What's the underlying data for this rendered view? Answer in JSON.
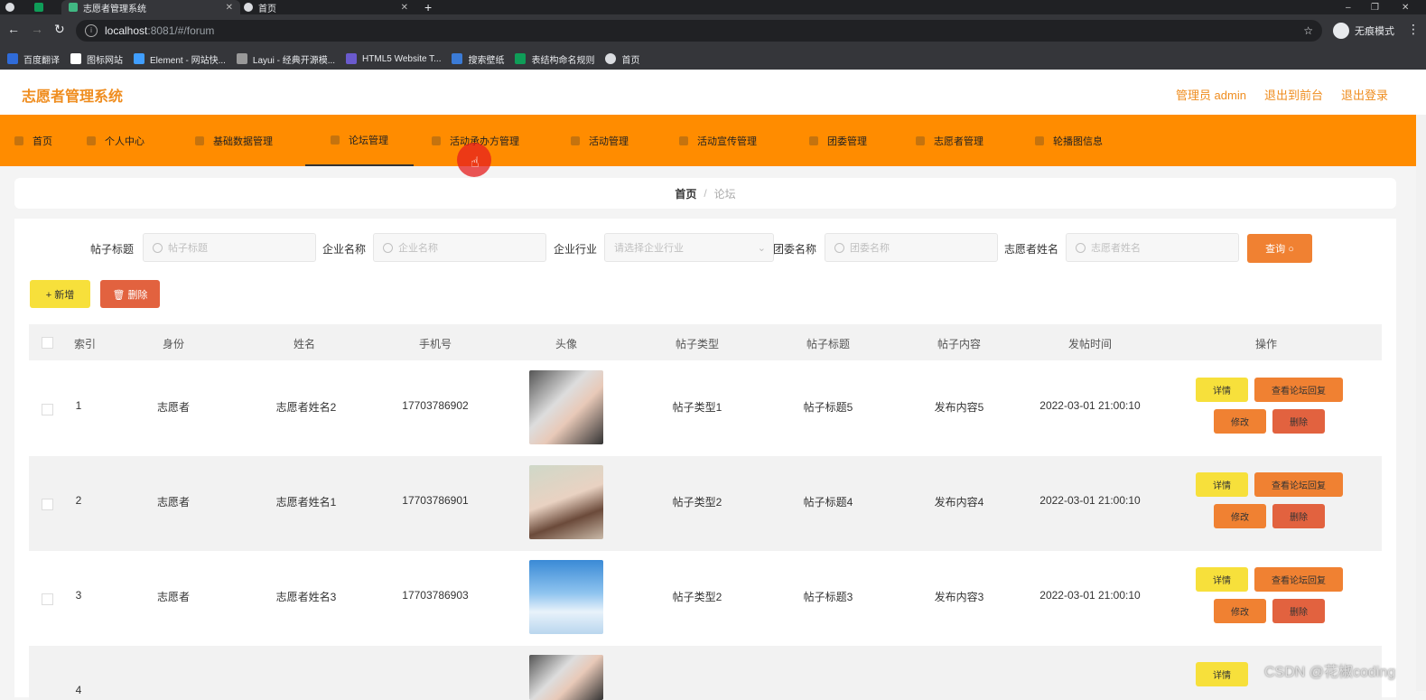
{
  "browser": {
    "tabs": [
      {
        "title": ""
      },
      {
        "title": ""
      },
      {
        "title": "志愿者管理系统"
      },
      {
        "title": "首页"
      }
    ],
    "new_tab": "+",
    "window_controls": [
      "–",
      "❐",
      "✕"
    ],
    "url_host": "localhost",
    "url_path": ":8081/#/forum",
    "incognito_label": "无痕模式",
    "bookmarks": [
      {
        "label": "百度翻译",
        "color": "#2f6bd8"
      },
      {
        "label": "图标网站",
        "color": "#ffffff"
      },
      {
        "label": "Element - 网站快...",
        "color": "#409eff"
      },
      {
        "label": "Layui - 经典开源模...",
        "color": "#999999"
      },
      {
        "label": "HTML5 Website T...",
        "color": "#6a5acd"
      },
      {
        "label": "搜索壁纸",
        "color": "#3b7bd6"
      },
      {
        "label": "表结构命名规则",
        "color": "#0f9d58"
      },
      {
        "label": "首页",
        "color": "#dadce0"
      }
    ]
  },
  "header": {
    "title": "志愿者管理系统",
    "admin": "管理员 admin",
    "to_front": "退出到前台",
    "logout": "退出登录"
  },
  "menu": [
    {
      "label": "首页"
    },
    {
      "label": "个人中心"
    },
    {
      "label": "基础数据管理"
    },
    {
      "label": "论坛管理"
    },
    {
      "label": "活动承办方管理"
    },
    {
      "label": "活动管理"
    },
    {
      "label": "活动宣传管理"
    },
    {
      "label": "团委管理"
    },
    {
      "label": "志愿者管理"
    },
    {
      "label": "轮播图信息"
    }
  ],
  "breadcrumb": {
    "home": "首页",
    "sep": "/",
    "current": "论坛"
  },
  "search": {
    "fields": [
      {
        "label": "帖子标题",
        "placeholder": "帖子标题"
      },
      {
        "label": "企业名称",
        "placeholder": "企业名称"
      },
      {
        "label": "企业行业",
        "placeholder": "请选择企业行业"
      },
      {
        "label": "团委名称",
        "placeholder": "团委名称"
      },
      {
        "label": "志愿者姓名",
        "placeholder": "志愿者姓名"
      }
    ],
    "query_label": "查询 ○"
  },
  "actions": {
    "add_label": "+ 新增",
    "delete_label": "🗑 删除"
  },
  "table": {
    "columns": [
      "索引",
      "身份",
      "姓名",
      "手机号",
      "头像",
      "帖子类型",
      "帖子标题",
      "帖子内容",
      "发帖时间",
      "操作"
    ],
    "rows": [
      {
        "index": "1",
        "role": "志愿者",
        "name": "志愿者姓名2",
        "phone": "17703786902",
        "type": "帖子类型1",
        "title": "帖子标题5",
        "content": "发布内容5",
        "time": "2022-03-01 21:00:10"
      },
      {
        "index": "2",
        "role": "志愿者",
        "name": "志愿者姓名1",
        "phone": "17703786901",
        "type": "帖子类型2",
        "title": "帖子标题4",
        "content": "发布内容4",
        "time": "2022-03-01 21:00:10"
      },
      {
        "index": "3",
        "role": "志愿者",
        "name": "志愿者姓名3",
        "phone": "17703786903",
        "type": "帖子类型2",
        "title": "帖子标题3",
        "content": "发布内容3",
        "time": "2022-03-01 21:00:10"
      },
      {
        "index": "4",
        "role": "",
        "name": "",
        "phone": "",
        "type": "",
        "title": "",
        "content": "",
        "time": ""
      }
    ],
    "row_actions": {
      "detail": "详情",
      "reply": "查看论坛回复",
      "edit": "修改",
      "delete": "删除"
    }
  },
  "watermark": "CSDN @花椒coding",
  "colors": {
    "accent": "#ff8c00",
    "title": "#ef8d1f",
    "yellow": "#f7e03b",
    "orange": "#f08132",
    "red": "#e2623f"
  }
}
